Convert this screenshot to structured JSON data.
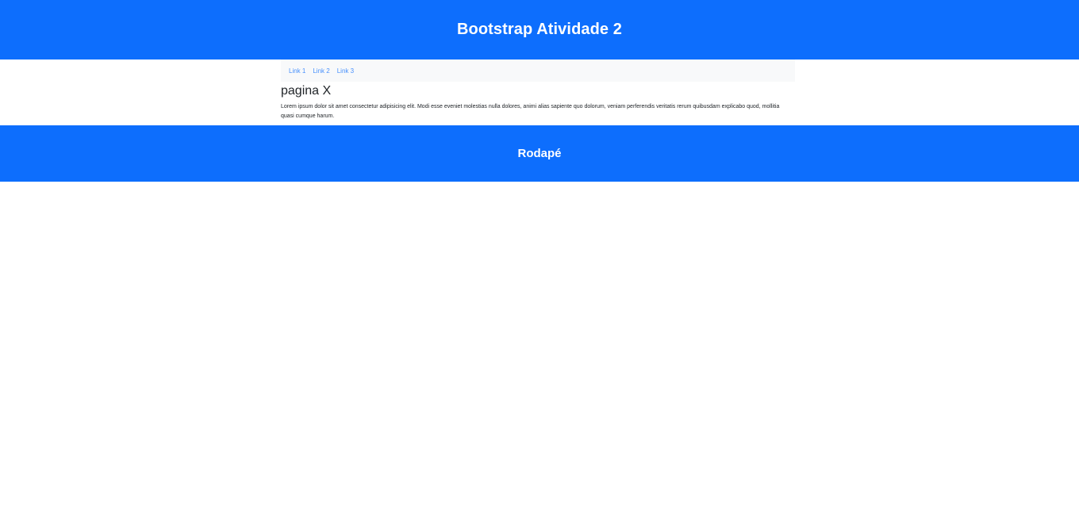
{
  "header": {
    "title": "Bootstrap Atividade 2"
  },
  "nav": {
    "links": [
      {
        "label": "Link 1"
      },
      {
        "label": "Link 2"
      },
      {
        "label": "Link 3"
      }
    ]
  },
  "main": {
    "title": "pagina X",
    "text": "Lorem ipsum dolor sit amet consectetur adipisicing elit. Modi esse eveniet molestias nulla dolores, animi alias sapiente quo dolorum, veniam perferendis veritatis rerum quibusdam explicabo quod, mollitia quasi cumque harum."
  },
  "footer": {
    "title": "Rodapé"
  },
  "colors": {
    "primary": "#0d6efd",
    "nav_background": "#f8f9fa",
    "text": "#212529"
  }
}
